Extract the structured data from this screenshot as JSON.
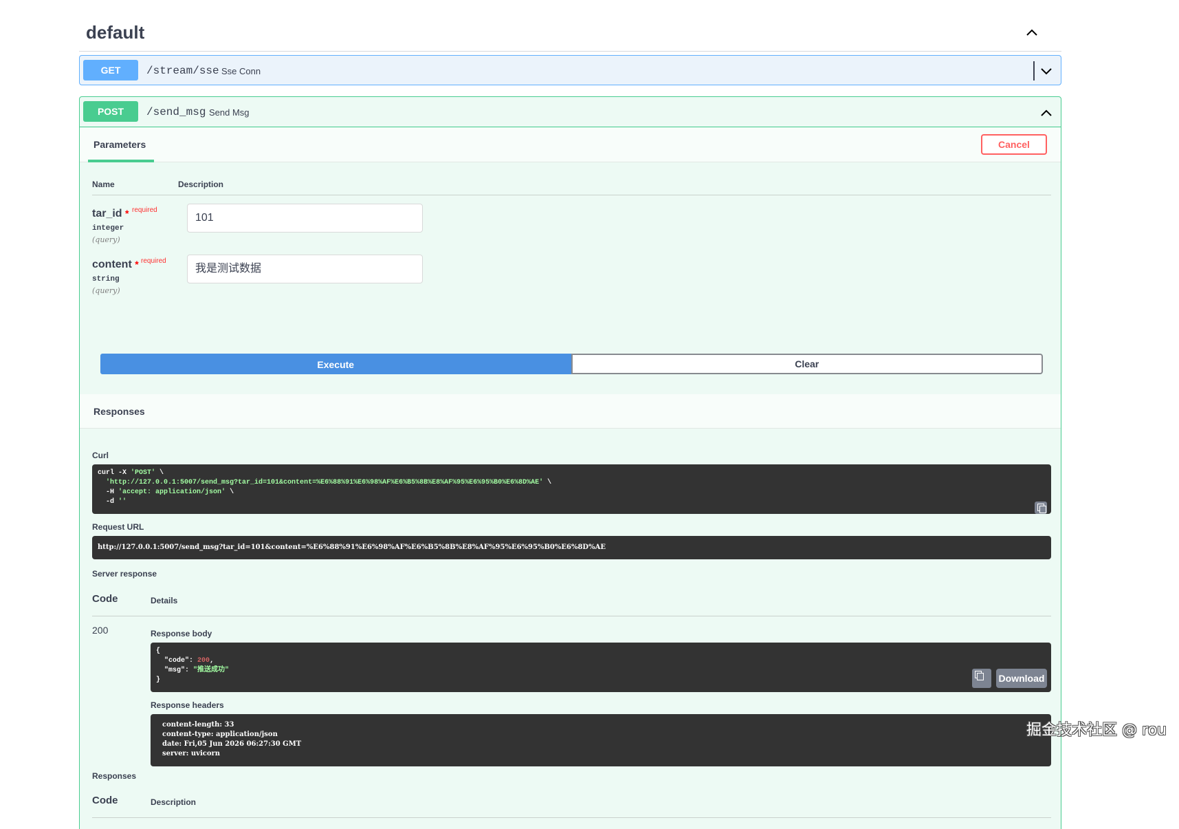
{
  "section": {
    "title": "default"
  },
  "get_op": {
    "method": "GET",
    "path": "/stream/sse",
    "summary": "Sse Conn"
  },
  "post_op": {
    "method": "POST",
    "path": "/send_msg",
    "summary": "Send Msg",
    "tab_label": "Parameters",
    "cancel_label": "Cancel",
    "headers": {
      "name": "Name",
      "description": "Description"
    },
    "params": [
      {
        "name": "tar_id",
        "required": "required",
        "type": "integer",
        "in": "(query)",
        "value": "101"
      },
      {
        "name": "content",
        "required": "required",
        "type": "string",
        "in": "(query)",
        "value": "我是测试数据"
      }
    ],
    "execute_label": "Execute",
    "clear_label": "Clear",
    "responses_title": "Responses",
    "curl_label": "Curl",
    "curl": {
      "line1_a": "curl -X ",
      "line1_b": "'POST'",
      "line1_c": " \\",
      "line2": "'http://127.0.0.1:5007/send_msg?tar_id=101&content=%E6%88%91%E6%98%AF%E6%B5%8B%E8%AF%95%E6%95%B0%E6%8D%AE'",
      "line2_end": " \\",
      "line3_a": "-H ",
      "line3_b": "'accept: application/json'",
      "line3_c": " \\",
      "line4_a": "-d ",
      "line4_b": "''"
    },
    "request_url_label": "Request URL",
    "request_url": "http://127.0.0.1:5007/send_msg?tar_id=101&content=%E6%88%91%E6%98%AF%E6%B5%8B%E8%AF%95%E6%95%B0%E6%8D%AE",
    "server_response_label": "Server response",
    "code_header": "Code",
    "details_header": "Details",
    "status_code": "200",
    "response_body_label": "Response body",
    "body": {
      "open": "{",
      "code_key": "\"code\"",
      "code_val": "200",
      "msg_key": "\"msg\"",
      "msg_val": "\"推送成功\"",
      "close": "}"
    },
    "download_label": "Download",
    "response_headers_label": "Response headers",
    "headers_text": [
      "content-length: 33",
      "content-type: application/json",
      "date: Fri,05 Jun 2026 06:27:30 GMT",
      "server: uvicorn"
    ],
    "responses_label2": "Responses",
    "code_header2": "Code",
    "description_header2": "Description"
  },
  "watermark": "掘金技术社区 @ rou"
}
